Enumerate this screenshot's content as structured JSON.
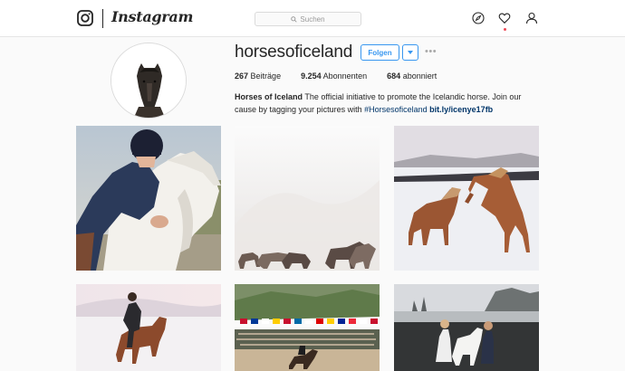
{
  "header": {
    "logo_text": "Instagram",
    "search_placeholder": "Suchen",
    "icons": [
      "instagram-glyph-icon",
      "search-icon",
      "compass-icon",
      "heart-icon",
      "person-icon"
    ],
    "notification_dot_color": "#ed4956"
  },
  "profile": {
    "username": "horsesoficeland",
    "follow_label": "Folgen",
    "stats": {
      "posts_count": "267",
      "posts_label": "Beiträge",
      "followers_count": "9.254",
      "followers_label": "Abonnenten",
      "following_count": "684",
      "following_label": "abonniert"
    },
    "bio": {
      "name": "Horses of Iceland",
      "text": "The official initiative to promote the Icelandic horse. Join our cause by tagging your pictures with",
      "hashtag": "#Horsesoficeland",
      "link": "bit.ly/icenye17fb"
    }
  },
  "colors": {
    "accent": "#3897f0",
    "link": "#003569",
    "text": "#262626",
    "background": "#fafafa",
    "border": "#dbdbdb"
  },
  "posts": [
    {
      "subject": "rider hugging white horse"
    },
    {
      "subject": "horses in snowy haze"
    },
    {
      "subject": "two chestnut horses playing in snow"
    },
    {
      "subject": "rider on chestnut horse in snow"
    },
    {
      "subject": "flags and crowd at horse show"
    },
    {
      "subject": "women with white horse on black beach"
    }
  ]
}
